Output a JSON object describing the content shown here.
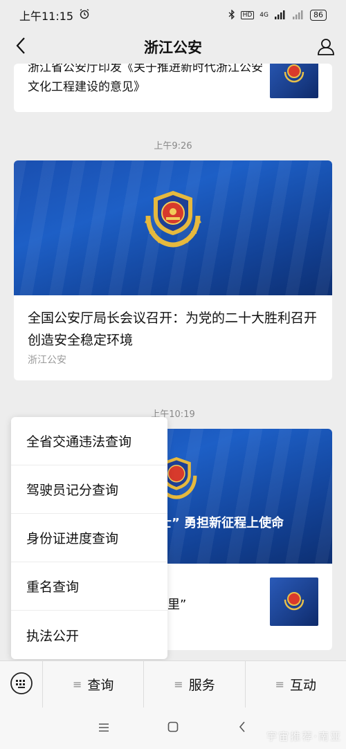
{
  "status_bar": {
    "time": "上午11:15",
    "battery": "86",
    "network": "4G"
  },
  "nav": {
    "title": "浙江公安"
  },
  "feed": {
    "top_card_text": "浙江省公安厅印发《关于推进新时代浙江公安文化工程建设的意见》",
    "time_1": "上午9:26",
    "article_1": {
      "title": "全国公安厅局长会议召开：为党的二十大胜利召开创造安全稳定环境",
      "source": "浙江公安"
    },
    "time_2": "上午10:19",
    "article_2": {
      "hero_text": "士” 勇担新征程上使命",
      "sub_text": "里”"
    }
  },
  "popup_menu": {
    "items": [
      "全省交通违法查询",
      "驾驶员记分查询",
      "身份证进度查询",
      "重名查询",
      "执法公开"
    ]
  },
  "menu_bar": {
    "tabs": [
      "查询",
      "服务",
      "互动"
    ]
  },
  "colors": {
    "brand_blue": "#1d5fc6",
    "background": "#ededed"
  },
  "icons": [
    "back-arrow-icon",
    "profile-icon",
    "keyboard-icon",
    "menu-icon",
    "police-emblem-icon",
    "home-icon"
  ],
  "watermark": "宇宙推荐·南亚"
}
